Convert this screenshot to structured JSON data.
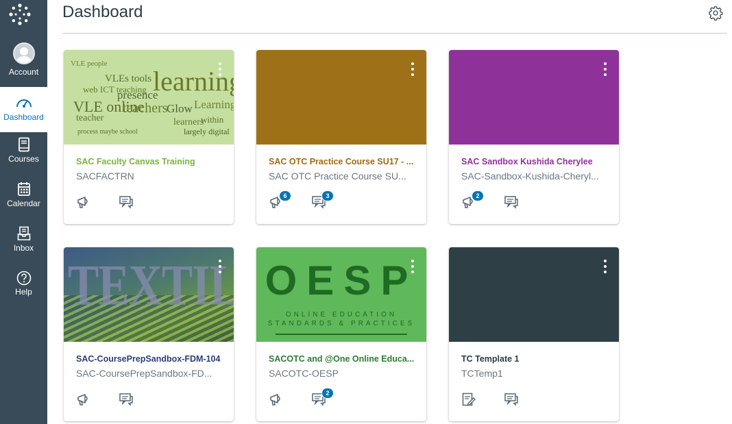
{
  "header": {
    "title": "Dashboard"
  },
  "nav": {
    "items": [
      {
        "label": "Account"
      },
      {
        "label": "Dashboard"
      },
      {
        "label": "Courses"
      },
      {
        "label": "Calendar"
      },
      {
        "label": "Inbox"
      },
      {
        "label": "Help"
      }
    ]
  },
  "colors": {
    "nav_bg": "#394b58",
    "active_link": "#0374b5",
    "badge": "#0374b5"
  },
  "cards": [
    {
      "title": "SAC Faculty Canvas Training",
      "code": "SACFACTRN",
      "title_color": "#7cb342",
      "hero": "word-cloud-learning",
      "icons": [
        "announcements-icon",
        "discussions-icon"
      ],
      "badges": [
        "",
        ""
      ]
    },
    {
      "title": "SAC OTC Practice Course SU17 - ...",
      "code": "SAC OTC Practice Course SU...",
      "title_color": "#9c6a12",
      "hero_color": "#9e7119",
      "icons": [
        "announcements-icon",
        "discussions-icon"
      ],
      "badges": [
        "6",
        "3"
      ]
    },
    {
      "title": "SAC Sandbox Kushida Cherylee",
      "code": "SAC-Sandbox-Kushida-Cheryl...",
      "title_color": "#8e3299",
      "hero_color": "#8e3299",
      "icons": [
        "announcements-icon",
        "discussions-icon"
      ],
      "badges": [
        "2",
        ""
      ]
    },
    {
      "title": "SAC-CoursePrepSandbox-FDM-104",
      "code": "SAC-CoursePrepSandbox-FD...",
      "title_color": "#2b3f7a",
      "hero": "textiles",
      "hero_text": "TEXTILES",
      "icons": [
        "announcements-icon",
        "discussions-icon"
      ],
      "badges": [
        "",
        ""
      ]
    },
    {
      "title": "SACOTC and @One Online Educa...",
      "code": "SACOTC-OESP",
      "title_color": "#2e7d32",
      "hero": "oesp",
      "hero_text": "OESP",
      "hero_sub": "ONLINE EDUCATION STANDARDS & PRACTICES",
      "icons": [
        "announcements-icon",
        "discussions-icon"
      ],
      "badges": [
        "",
        "2"
      ]
    },
    {
      "title": "TC Template 1",
      "code": "TCTemp1",
      "title_color": "#2d3b45",
      "hero_color": "#2f3f46",
      "icons": [
        "assignments-icon",
        "discussions-icon"
      ],
      "badges": [
        "",
        ""
      ]
    }
  ]
}
